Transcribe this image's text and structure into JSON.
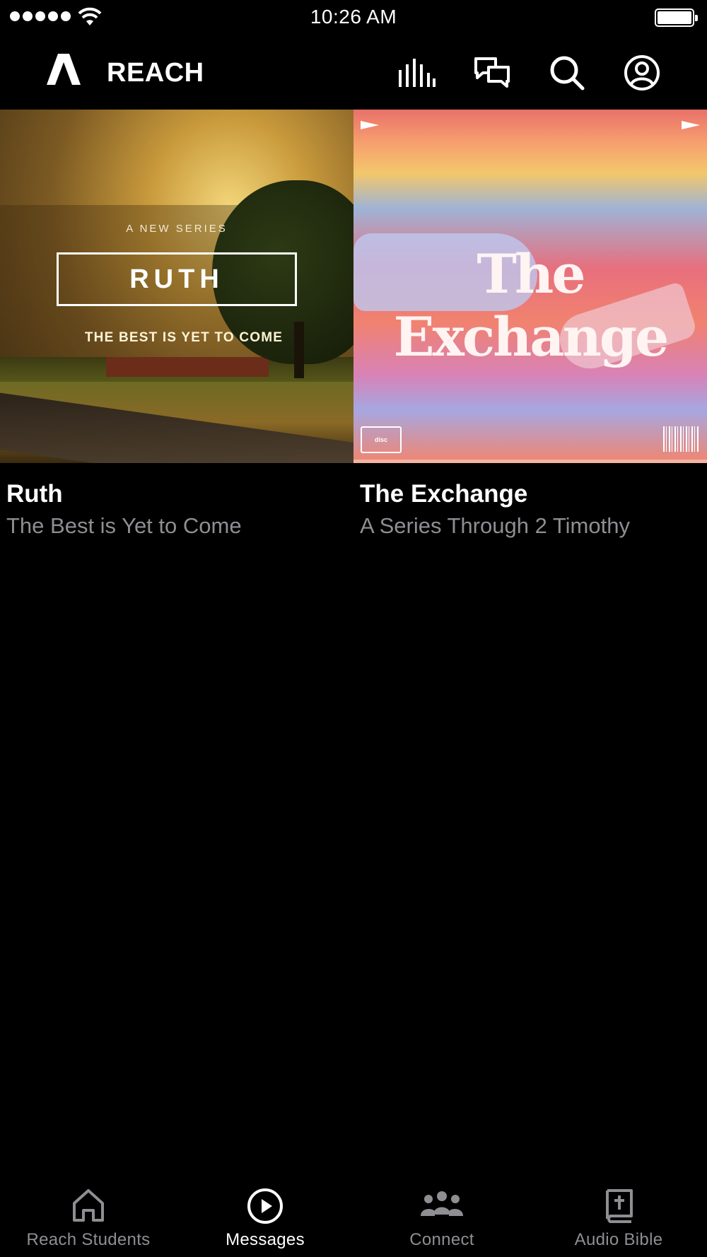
{
  "status_bar": {
    "time": "10:26 AM",
    "signal_icon": "signal-dots-icon",
    "wifi_icon": "wifi-icon",
    "battery_icon": "battery-icon",
    "battery_level": 1.0
  },
  "header": {
    "brand": "REACH",
    "logo_icon": "reach-logo-icon",
    "actions": [
      {
        "icon": "audio-bars-icon"
      },
      {
        "icon": "chat-bubbles-icon"
      },
      {
        "icon": "search-icon"
      },
      {
        "icon": "profile-icon"
      }
    ]
  },
  "series": [
    {
      "title": "Ruth",
      "subtitle": "The Best is Yet to Come",
      "cover": {
        "kicker": "A NEW SERIES",
        "title": "RUTH",
        "tagline": "THE BEST IS YET TO COME"
      }
    },
    {
      "title": "The Exchange",
      "subtitle": "A Series Through 2 Timothy",
      "cover": {
        "title": "The Exchange",
        "disc_logo": "disc"
      }
    }
  ],
  "tabs": [
    {
      "label": "Reach Students",
      "icon": "home-icon",
      "active": false
    },
    {
      "label": "Messages",
      "icon": "play-circle-icon",
      "active": true
    },
    {
      "label": "Connect",
      "icon": "people-icon",
      "active": false
    },
    {
      "label": "Audio Bible",
      "icon": "bible-icon",
      "active": false
    }
  ],
  "colors": {
    "background": "#000000",
    "text_primary": "#ffffff",
    "text_secondary": "#8e8e93"
  }
}
